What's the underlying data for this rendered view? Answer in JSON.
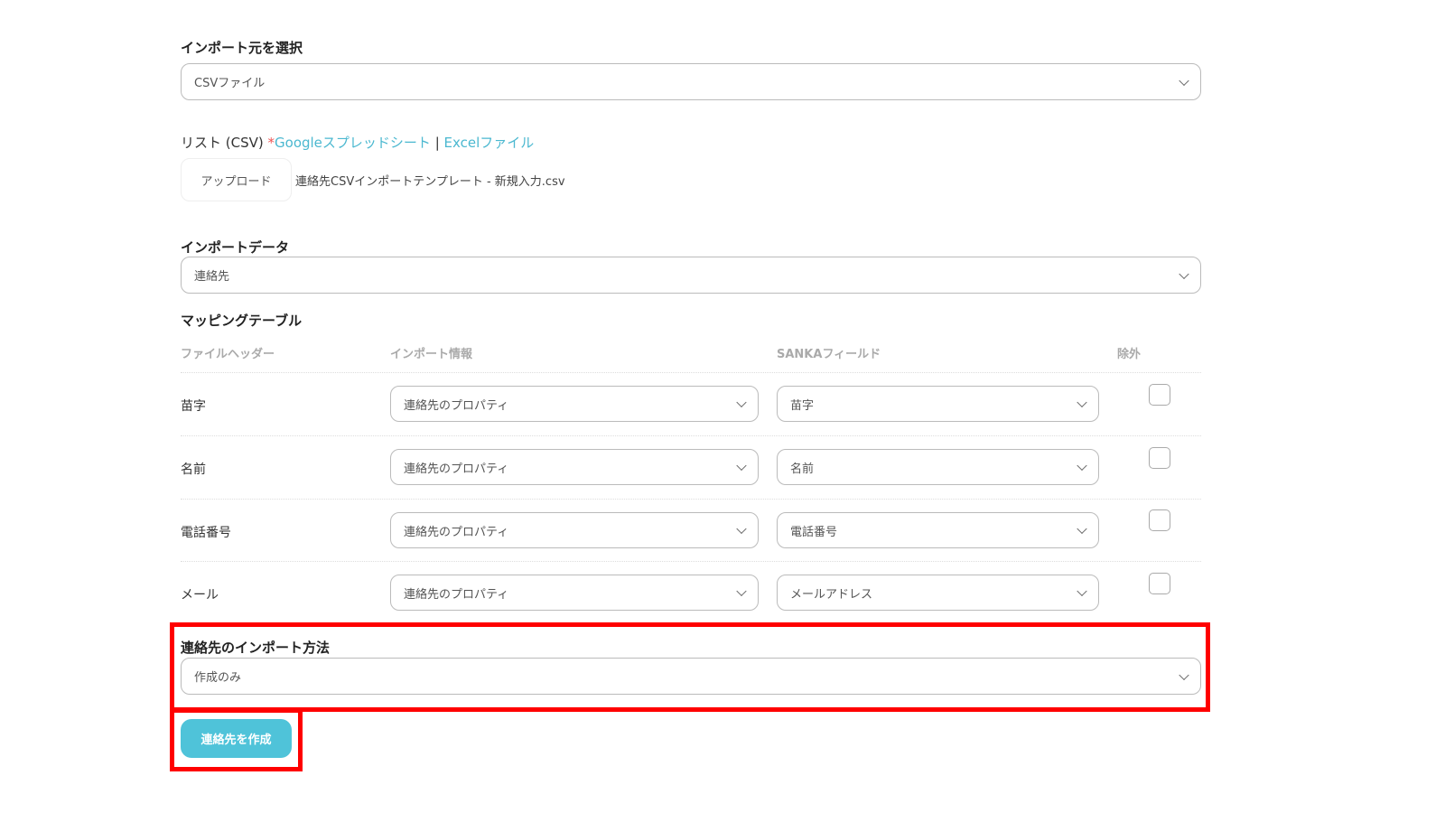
{
  "source": {
    "label": "インポート元を選択",
    "value": "CSVファイル"
  },
  "list": {
    "label": "リスト (CSV)",
    "asterisk": "*",
    "google_link": "Googleスプレッドシート",
    "separator": "|",
    "excel_link": "Excelファイル",
    "upload_button": "アップロード",
    "file_name": "連絡先CSVインポートテンプレート - 新規入力.csv"
  },
  "import_data": {
    "label": "インポートデータ",
    "value": "連絡先"
  },
  "mapping": {
    "title": "マッピングテーブル",
    "headers": [
      "ファイルヘッダー",
      "インポート情報",
      "SANKAフィールド",
      "除外"
    ],
    "rows": [
      {
        "header": "苗字",
        "info": "連絡先のプロパティ",
        "field": "苗字"
      },
      {
        "header": "名前",
        "info": "連絡先のプロパティ",
        "field": "名前"
      },
      {
        "header": "電話番号",
        "info": "連絡先のプロパティ",
        "field": "電話番号"
      },
      {
        "header": "メール",
        "info": "連絡先のプロパティ",
        "field": "メールアドレス"
      }
    ]
  },
  "method": {
    "label": "連絡先のインポート方法",
    "value": "作成のみ"
  },
  "submit": {
    "label": "連絡先を作成"
  },
  "colors": {
    "accent": "#4fc3d9",
    "link": "#4bb8d0",
    "highlight": "#ff0000"
  }
}
